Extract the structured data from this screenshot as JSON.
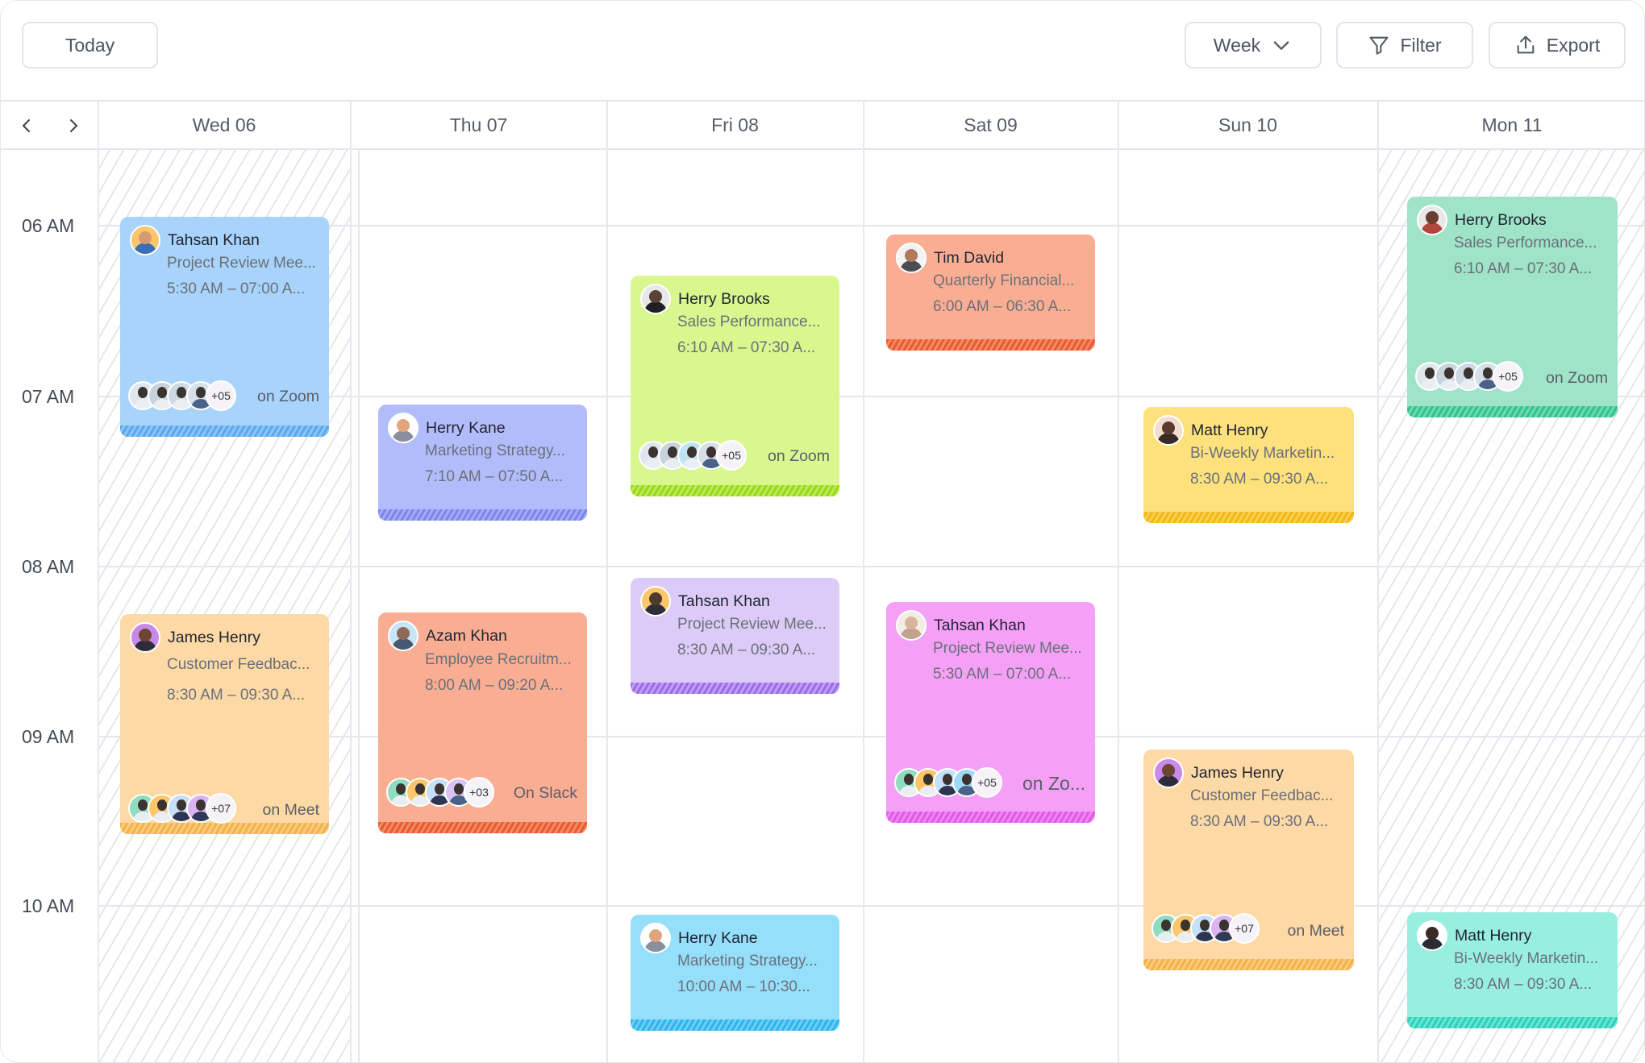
{
  "toolbar": {
    "today": "Today",
    "view": "Week",
    "filter": "Filter",
    "export": "Export"
  },
  "days": [
    "Wed 06",
    "Thu 07",
    "Fri 08",
    "Sat 09",
    "Sun 10",
    "Mon 11"
  ],
  "hours": [
    "06 AM",
    "07 AM",
    "08 AM",
    "09 AM",
    "10 AM"
  ],
  "events": {
    "e1": {
      "name": "Tahsan Khan",
      "title": "Project Review Mee...",
      "time": "5:30 AM – 07:00 A...",
      "more": "+05",
      "platform": "on Zoom"
    },
    "e2": {
      "name": "James Henry",
      "title": "Customer Feedbac...",
      "time": "8:30 AM – 09:30 A...",
      "more": "+07",
      "platform": "on Meet"
    },
    "e3": {
      "name": "Herry Kane",
      "title": "Marketing Strategy...",
      "time": "7:10 AM – 07:50 A..."
    },
    "e4": {
      "name": "Azam Khan",
      "title": "Employee Recruitm...",
      "time": "8:00 AM – 09:20 A...",
      "more": "+03",
      "platform": "On Slack"
    },
    "e5": {
      "name": "Herry Brooks",
      "title": "Sales Performance...",
      "time": "6:10 AM – 07:30 A...",
      "more": "+05",
      "platform": "on Zoom"
    },
    "e6": {
      "name": "Tahsan Khan",
      "title": "Project Review Mee...",
      "time": "8:30 AM – 09:30 A..."
    },
    "e7": {
      "name": "Herry Kane",
      "title": "Marketing Strategy...",
      "time": "10:00 AM – 10:30..."
    },
    "e8": {
      "name": "Tim David",
      "title": "Quarterly Financial...",
      "time": "6:00 AM – 06:30 A..."
    },
    "e9": {
      "name": "Tahsan Khan",
      "title": "Project Review Mee...",
      "time": "5:30 AM – 07:00 A...",
      "more": "+05",
      "platform": "on Zo..."
    },
    "e10": {
      "name": "Matt Henry",
      "title": "Bi-Weekly Marketin...",
      "time": "8:30 AM – 09:30 A..."
    },
    "e11": {
      "name": "James Henry",
      "title": "Customer Feedbac...",
      "time": "8:30 AM – 09:30 A...",
      "more": "+07",
      "platform": "on Meet"
    },
    "e12": {
      "name": "Herry Brooks",
      "title": "Sales Performance...",
      "time": "6:10 AM – 07:30 A...",
      "more": "+05",
      "platform": "on Zoom"
    },
    "e13": {
      "name": "Matt Henry",
      "title": "Bi-Weekly Marketin...",
      "time": "8:30 AM – 09:30 A..."
    }
  },
  "colors": {
    "blue": "#a8d3fb",
    "peach": "#fdd9a6",
    "lavender": "#b3bcfa",
    "salmon": "#f9ae94",
    "lime": "#d8f78f",
    "lilac": "#dccbf7",
    "sky": "#95dffb",
    "orange": "#f9ae94",
    "pink": "#f4a0f6",
    "yellow": "#fde17d",
    "mint": "#9fe3c8",
    "aqua": "#98efe0"
  }
}
